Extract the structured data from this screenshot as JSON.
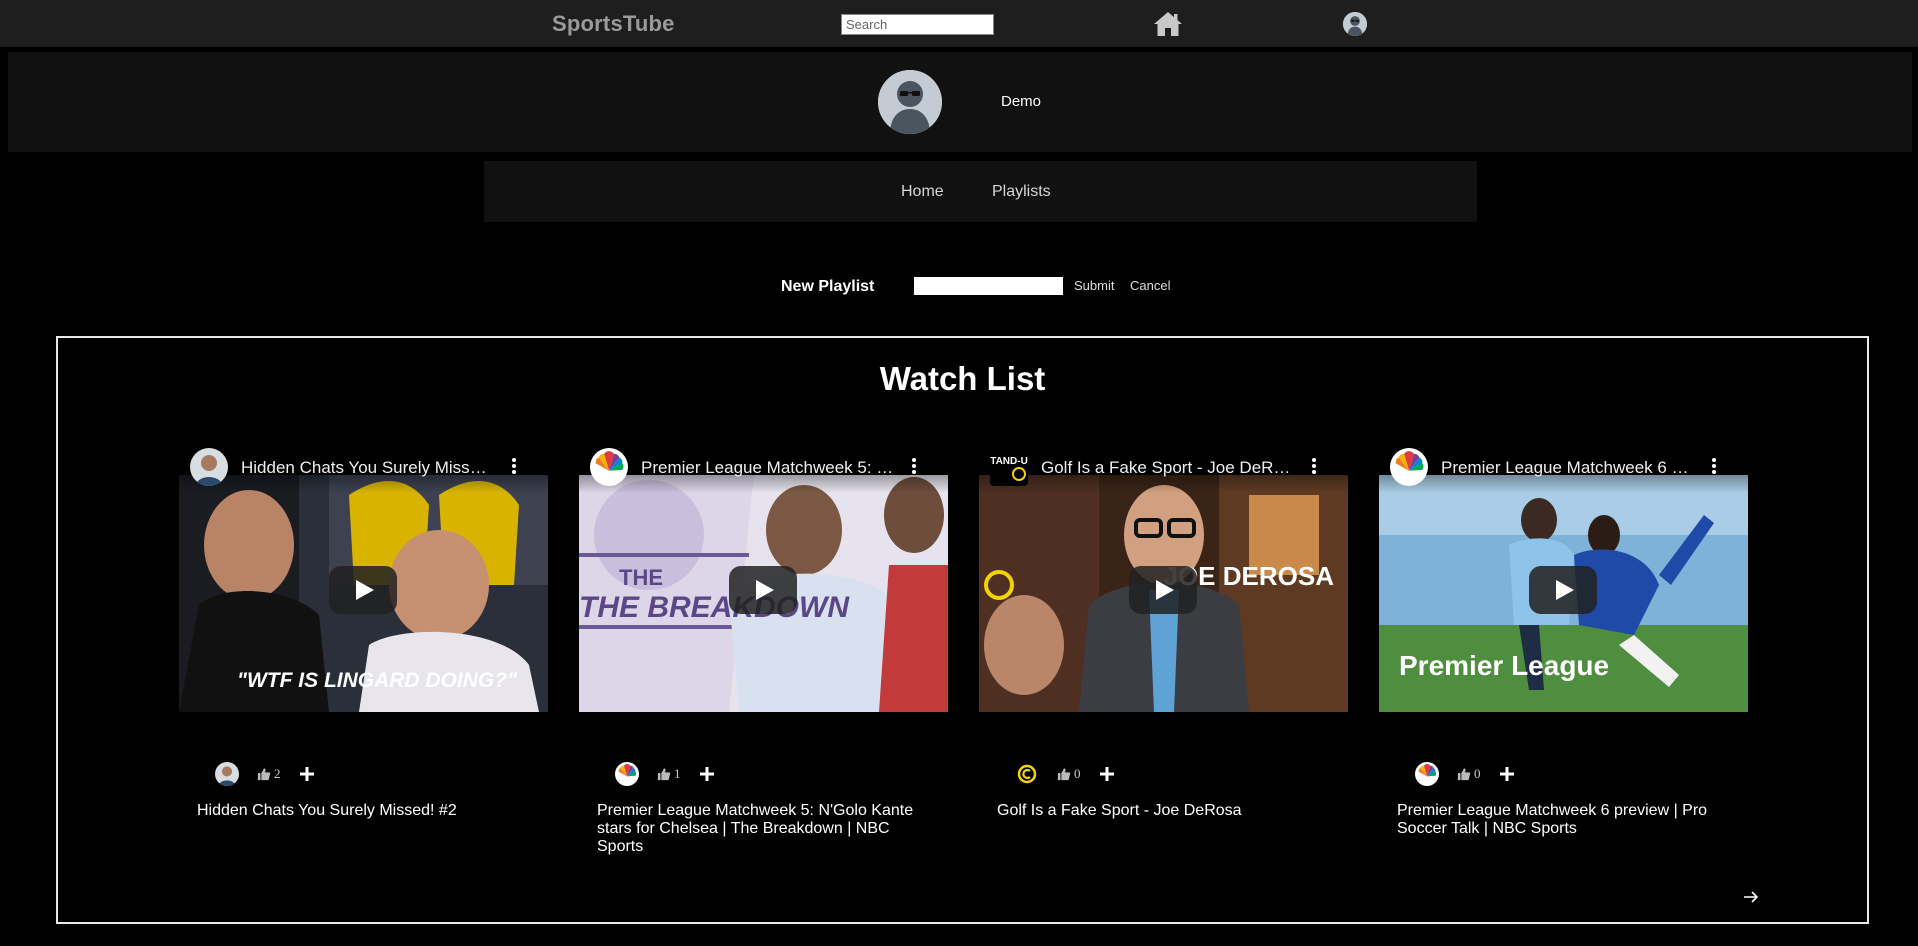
{
  "header": {
    "brand": "SportsTube",
    "search_placeholder": "Search",
    "home_icon": "home-icon",
    "profile_icon": "avatar-icon"
  },
  "profile": {
    "username": "Demo"
  },
  "nav": {
    "home": "Home",
    "playlists": "Playlists"
  },
  "new_playlist": {
    "label": "New Playlist",
    "input_value": "",
    "submit": "Submit",
    "cancel": "Cancel"
  },
  "watch_list": {
    "title": "Watch List",
    "videos": [
      {
        "embed_title": "Hidden Chats You Surely Missed! #2",
        "thumb_caption": "\"WTF IS LINGARD DOING?\"",
        "likes": "2",
        "title": "Hidden Chats You Surely Missed! #2"
      },
      {
        "embed_title": "Premier League Matchweek 5: N'Golo Kante stars for Chelsea | The Breakdown | NBC Sports",
        "thumb_caption": "THE BREAKDOWN",
        "likes": "1",
        "title": "Premier League Matchweek 5: N'Golo Kante stars for Chelsea | The Breakdown | NBC Sports"
      },
      {
        "embed_title": "Golf Is a Fake Sport - Joe DeRosa",
        "thumb_caption": "JOE DEROSA",
        "channel_badge": "STAND-UP",
        "likes": "0",
        "title": "Golf Is a Fake Sport - Joe DeRosa"
      },
      {
        "embed_title": "Premier League Matchweek 6 preview | Pro Soccer Talk | NBC Sports",
        "thumb_caption": "Premier League",
        "likes": "0",
        "title": "Premier League Matchweek 6 preview | Pro Soccer Talk | NBC Sports"
      }
    ]
  },
  "colors": {
    "background": "#000000",
    "topbar": "#1e1e1e",
    "panel": "#111111",
    "brand": "#9a9a9a",
    "border": "#e8e8e8"
  }
}
